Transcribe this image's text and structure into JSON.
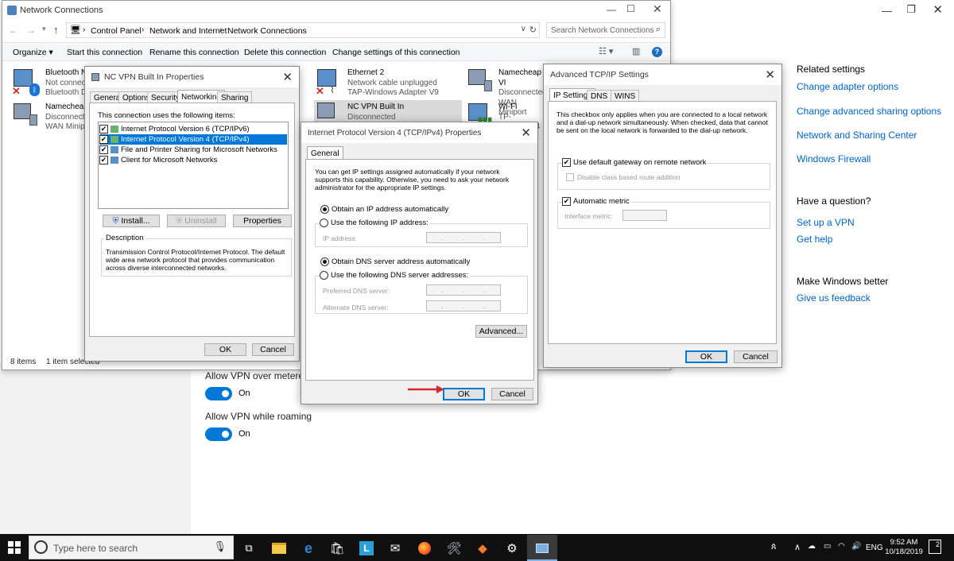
{
  "explorer": {
    "title": "Network Connections",
    "breadcrumb": [
      "Control Panel",
      "Network and Internet",
      "Network Connections"
    ],
    "search_placeholder": "Search Network Connections",
    "toolbar": [
      "Organize ▾",
      "Start this connection",
      "Rename this connection",
      "Delete this connection",
      "Change settings of this connection"
    ],
    "status_items": "8 items",
    "status_selected": "1 item selected",
    "connections": [
      {
        "name": "Bluetooth Ne",
        "status": "Not connect",
        "device": "Bluetooth De"
      },
      {
        "name": "Namecheap-",
        "status": "Disconnect",
        "device": "WAN Minipo"
      },
      {
        "name": "Ethernet 2",
        "status": "Network cable unplugged",
        "device": "TAP-Windows Adapter V9"
      },
      {
        "name": "NC VPN Built In",
        "status": "Disconnected",
        "device": ""
      },
      {
        "name": "Namecheap VI",
        "status": "Disconnected",
        "device": "WAN Miniport"
      },
      {
        "name": "Wi-Fi",
        "status": "TP-LINK_EB04",
        "device": ""
      }
    ]
  },
  "settings": {
    "related_title": "Related settings",
    "related_links": [
      "Change adapter options",
      "Change advanced sharing options",
      "Network and Sharing Center",
      "Windows Firewall"
    ],
    "question_title": "Have a question?",
    "question_links": [
      "Set up a VPN",
      "Get help"
    ],
    "better_title": "Make Windows better",
    "better_link": "Give us feedback",
    "metered_label": "Allow VPN over metered n",
    "metered_state": "On",
    "roaming_label": "Allow VPN while roaming",
    "roaming_state": "On"
  },
  "vpn_props": {
    "title": "NC VPN Built In Properties",
    "tabs": [
      "General",
      "Options",
      "Security",
      "Networking",
      "Sharing"
    ],
    "uses_label": "This connection uses the following items:",
    "items": [
      "Internet Protocol Version 6 (TCP/IPv6)",
      "Internet Protocol Version 4 (TCP/IPv4)",
      "File and Printer Sharing for Microsoft Networks",
      "Client for Microsoft Networks"
    ],
    "install": "Install...",
    "uninstall": "Uninstall",
    "properties": "Properties",
    "desc_title": "Description",
    "desc_text": "Transmission Control Protocol/Internet Protocol. The default wide area network protocol that provides communication across diverse interconnected networks.",
    "ok": "OK",
    "cancel": "Cancel"
  },
  "ipv4": {
    "title": "Internet Protocol Version 4 (TCP/IPv4) Properties",
    "tab": "General",
    "intro": "You can get IP settings assigned automatically if your network supports this capability. Otherwise, you need to ask your network administrator for the appropriate IP settings.",
    "obtain_ip": "Obtain an IP address automatically",
    "use_ip": "Use the following IP address:",
    "ip_address": "IP address:",
    "obtain_dns": "Obtain DNS server address automatically",
    "use_dns": "Use the following DNS server addresses:",
    "preferred_dns": "Preferred DNS server:",
    "alternate_dns": "Alternate DNS server:",
    "advanced": "Advanced...",
    "ok": "OK",
    "cancel": "Cancel"
  },
  "advanced": {
    "title": "Advanced TCP/IP Settings",
    "tabs": [
      "IP Settings",
      "DNS",
      "WINS"
    ],
    "info": "This checkbox only applies when you are connected to a local network and a dial-up network simultaneously.  When checked, data that cannot be sent on the local network is forwarded to the dial-up network.",
    "default_gateway": "Use default gateway on remote network",
    "class_route": "Disable class based route addition",
    "auto_metric": "Automatic metric",
    "interface_metric": "Interface metric:",
    "ok": "OK",
    "cancel": "Cancel"
  },
  "taskbar": {
    "search_placeholder": "Type here to search",
    "language": "ENG",
    "time": "9:52 AM",
    "date": "10/18/2019",
    "notifications": "2"
  },
  "colors": {
    "accent": "#0078d7",
    "taskbar": "#101010",
    "link": "#0064c8",
    "arrow": "#d9262b"
  }
}
